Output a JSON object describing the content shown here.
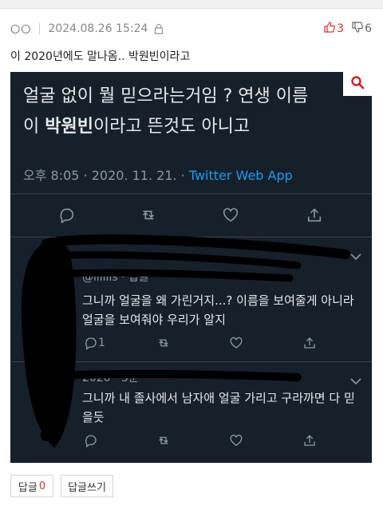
{
  "post": {
    "author": "○○",
    "datetime": "2024.08.26 15:24",
    "upvotes": "3",
    "downvotes": "6",
    "body": "이 2020년에도 말나옴.. 박원빈이라고"
  },
  "screenshot": {
    "tweet_line1": "얼굴 없이 뭘 믿으라는거임 ? 연생 이름",
    "tweet_line2_prefix": "이 ",
    "tweet_line2_bold": "박원빈",
    "tweet_line2_suffix": "이라고 뜬것도 아니고",
    "tweet_time": "오후 8:05 · 2020. 11. 21. · ",
    "tweet_source": "Twitter Web App",
    "reply1_meta": "@lilllls · 답글",
    "reply1_text": "그니까 얼굴을 왜 가린거지...? 이름을 보여줄게 아니라 얼굴을 보여줘야 우리가 알지",
    "reply1_reply_count": "1",
    "reply2_meta": "2020 · 5분",
    "reply2_text": "그니까 내 졸사에서 남자애 얼굴 가리고 구라까면 다 믿을듯"
  },
  "footer": {
    "reply_label": "답글",
    "reply_count": "0",
    "write_label": "답글쓰기"
  },
  "colors": {
    "accent_red": "#e0302a",
    "twitter_bg": "#15202b",
    "twitter_blue": "#1d9bf0"
  }
}
